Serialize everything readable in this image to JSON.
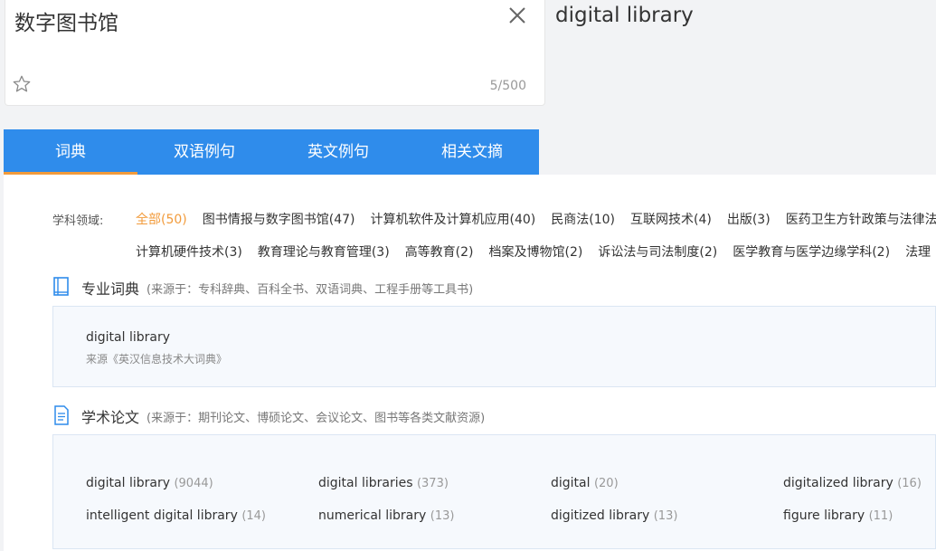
{
  "source": {
    "text": "数字图书馆",
    "counter": "5/500",
    "close_icon": "close-icon",
    "star_icon": "star-outline-icon"
  },
  "target": {
    "text": "digital library"
  },
  "tabs": [
    {
      "label": "词典",
      "active": true
    },
    {
      "label": "双语例句",
      "active": false
    },
    {
      "label": "英文例句",
      "active": false
    },
    {
      "label": "相关文摘",
      "active": false
    }
  ],
  "subjects": {
    "label": "学科领域:",
    "row1": [
      "全部(50)",
      "图书情报与数字图书馆(47)",
      "计算机软件及计算机应用(40)",
      "民商法(10)",
      "互联网技术(4)",
      "出版(3)",
      "医药卫生方针政策与法律法"
    ],
    "row2": [
      "计算机硬件技术(3)",
      "教育理论与教育管理(3)",
      "高等教育(2)",
      "档案及博物馆(2)",
      "诉讼法与司法制度(2)",
      "医学教育与医学边缘学科(2)",
      "法理"
    ]
  },
  "pro_dict": {
    "title": "专业词典",
    "subtitle": "(来源于：专科辞典、百科全书、双语词典、工程手册等工具书)",
    "icon": "book-icon",
    "term": "digital library",
    "source": "来源《英汉信息技术大词典》"
  },
  "papers": {
    "title": "学术论文",
    "subtitle": "(来源于：期刊论文、博硕论文、会议论文、图书等各类文献资源)",
    "icon": "document-icon",
    "items": [
      {
        "term": "digital library",
        "count": "(9044)"
      },
      {
        "term": "digital libraries",
        "count": "(373)"
      },
      {
        "term": "digital",
        "count": "(20)"
      },
      {
        "term": "digitalized library",
        "count": "(16)"
      },
      {
        "term": "intelligent digital library",
        "count": "(14)"
      },
      {
        "term": "numerical library",
        "count": "(13)"
      },
      {
        "term": "digitized library",
        "count": "(13)"
      },
      {
        "term": "figure library",
        "count": "(11)"
      }
    ]
  },
  "colors": {
    "tab_bar": "#2f8ceb",
    "active_accent": "#f29b3b",
    "section_box": "#f6f9fd"
  }
}
